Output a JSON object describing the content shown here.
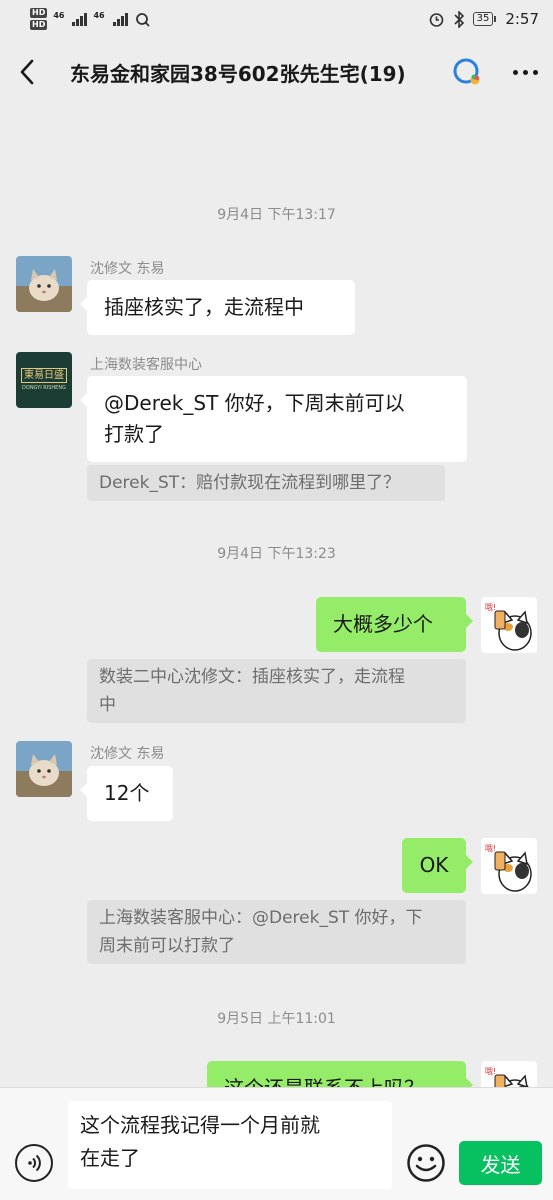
{
  "status_bar": {
    "hd1": "HD",
    "hd2": "HD",
    "net1": "46",
    "net2": "46",
    "battery": "35",
    "time": "2:57"
  },
  "header": {
    "title": "东易金和家园38号602张先生宅(19)"
  },
  "timestamps": [
    "9月4日 下午13:17",
    "9月4日 下午13:23",
    "9月5日 上午11:01"
  ],
  "messages": [
    {
      "sender": "沈修文 东易",
      "text": "插座核实了，走流程中"
    },
    {
      "sender": "上海数装客服中心",
      "text_line1": "@Derek_ST 你好，下周末前可以",
      "text_line2": "打款了",
      "quote": "Derek_ST：赔付款现在流程到哪里了？"
    },
    {
      "text": "大概多少个",
      "quote_line1": "数装二中心沈修文：插座核实了，走流程",
      "quote_line2": "中"
    },
    {
      "sender": "沈修文 东易",
      "text": "12个"
    },
    {
      "text": "OK",
      "quote_line1": "上海数装客服中心：@Derek_ST 你好，下",
      "quote_line2": "周末前可以打款了"
    },
    {
      "text": "这个还是联系不上吗？"
    }
  ],
  "avatar_logo": {
    "line1": "東易日盛",
    "line2": "DONGYI RISHENG"
  },
  "input": {
    "line1": "这个流程我记得一个月前就",
    "line2": "在走了",
    "send_label": "发送"
  },
  "colors": {
    "background": "#ededed",
    "outgoing_bubble": "#95ec69",
    "send_button": "#07c160"
  }
}
